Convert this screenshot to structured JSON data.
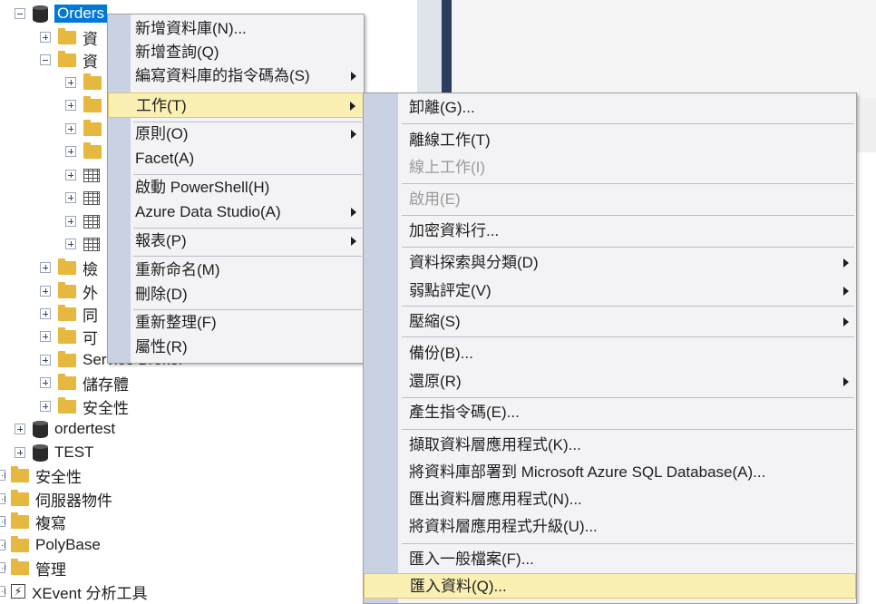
{
  "tree": {
    "orders": "Orders",
    "child_stubs": [
      "資",
      "資"
    ],
    "sub_stubs": [
      "檢",
      "外",
      "同",
      "可"
    ],
    "service_broker": "Service Broker",
    "storage": "儲存體",
    "security_db": "安全性",
    "ordertest": "ordertest",
    "test": "TEST",
    "security": "安全性",
    "server_objects": "伺服器物件",
    "replication": "複寫",
    "polybase": "PolyBase",
    "management": "管理",
    "xevent": "XEvent 分析工具"
  },
  "context_menu": {
    "items": [
      {
        "label": "新增資料庫(N)..."
      },
      {
        "label": "新增查詢(Q)"
      },
      {
        "label": "編寫資料庫的指令碼為(S)"
      },
      {
        "label": "工作(T)"
      },
      {
        "label": "原則(O)"
      },
      {
        "label": "Facet(A)"
      },
      {
        "label": "啟動 PowerShell(H)"
      },
      {
        "label": "Azure Data Studio(A)"
      },
      {
        "label": "報表(P)"
      },
      {
        "label": "重新命名(M)"
      },
      {
        "label": "刪除(D)"
      },
      {
        "label": "重新整理(F)"
      },
      {
        "label": "屬性(R)"
      }
    ]
  },
  "tasks_menu": {
    "items": [
      {
        "label": "卸離(G)..."
      },
      {
        "label": "離線工作(T)"
      },
      {
        "label": "線上工作(I)"
      },
      {
        "label": "啟用(E)"
      },
      {
        "label": "加密資料行..."
      },
      {
        "label": "資料探索與分類(D)"
      },
      {
        "label": "弱點評定(V)"
      },
      {
        "label": "壓縮(S)"
      },
      {
        "label": "備份(B)..."
      },
      {
        "label": "還原(R)"
      },
      {
        "label": "產生指令碼(E)..."
      },
      {
        "label": "擷取資料層應用程式(K)..."
      },
      {
        "label": "將資料庫部署到 Microsoft Azure SQL Database(A)..."
      },
      {
        "label": "匯出資料層應用程式(N)..."
      },
      {
        "label": "將資料層應用程式升級(U)..."
      },
      {
        "label": "匯入一般檔案(F)..."
      },
      {
        "label": "匯入資料(Q)..."
      }
    ]
  },
  "colors": {
    "selection": "#0078d7",
    "menu_highlight": "#fbf0b4",
    "gutter": "#c8d2e3"
  }
}
